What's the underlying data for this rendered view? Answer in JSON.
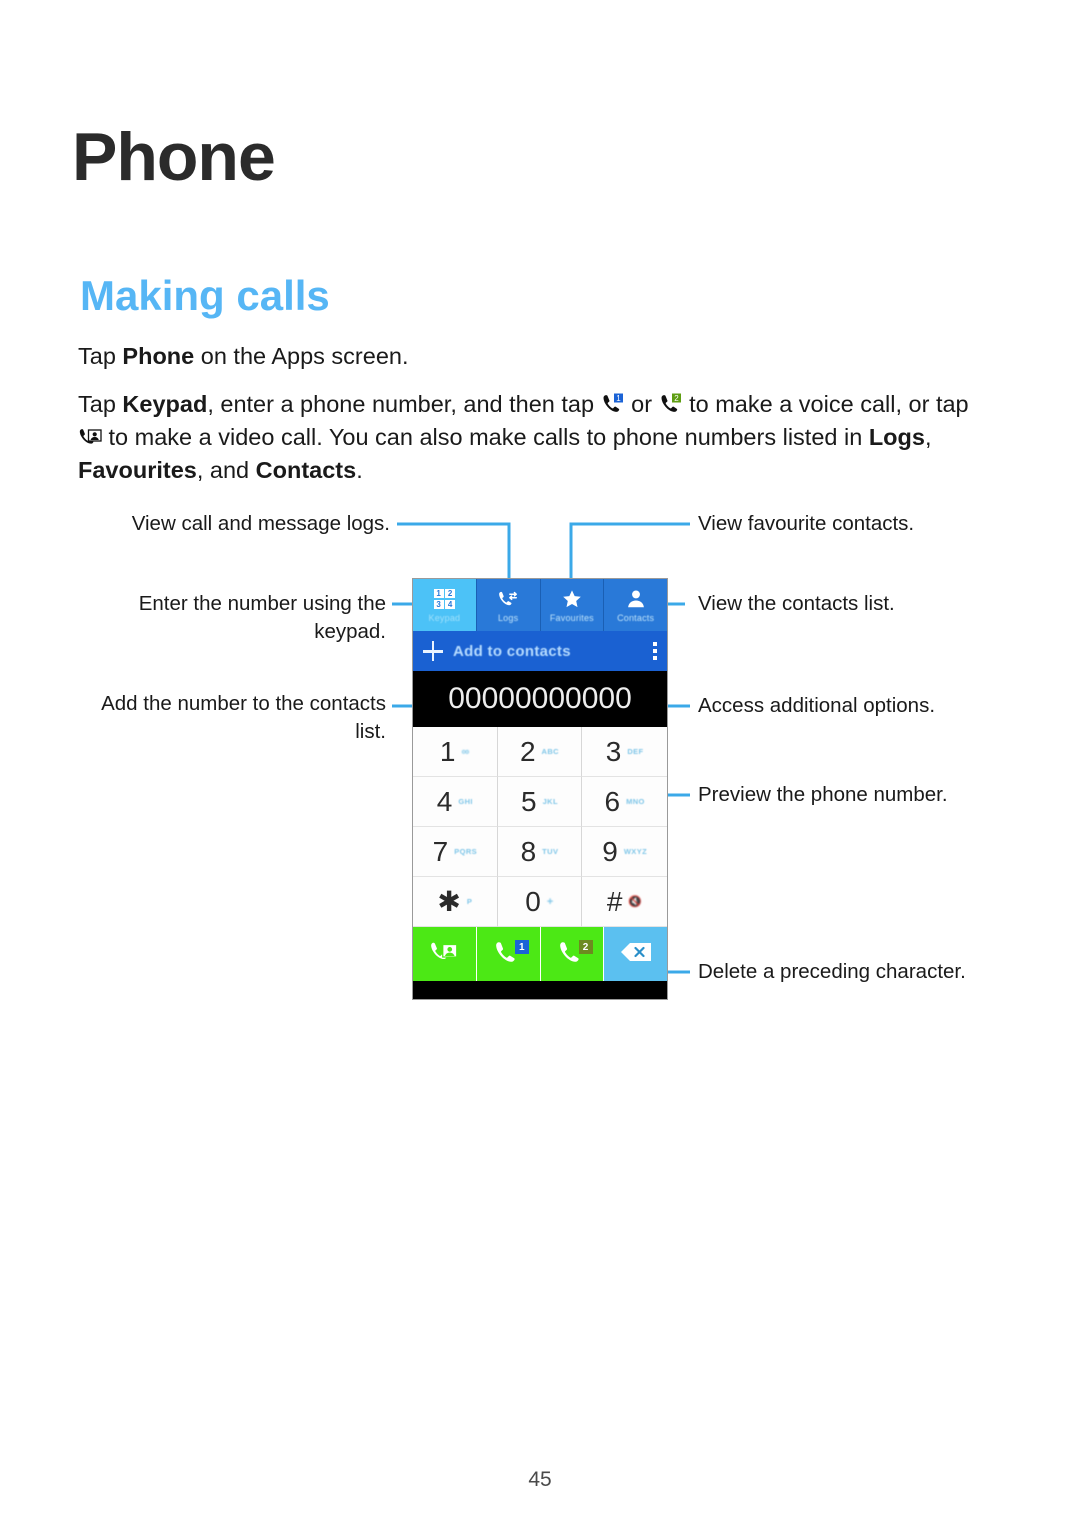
{
  "page": {
    "title": "Phone",
    "section_title": "Making calls",
    "page_number": "45"
  },
  "body": {
    "paragraph1_pre": "Tap ",
    "paragraph1_bold": "Phone",
    "paragraph1_post": " on the Apps screen.",
    "paragraph2_a": "Tap ",
    "paragraph2_b": "Keypad",
    "paragraph2_c": ", enter a phone number, and then tap ",
    "paragraph2_d": " or ",
    "paragraph2_e": " to make a voice call, or tap ",
    "paragraph2_f": " to make a video call. You can also make calls to phone numbers listed in ",
    "paragraph2_g": "Logs",
    "paragraph2_h": ", ",
    "paragraph2_i": "Favourites",
    "paragraph2_j": ", and ",
    "paragraph2_k": "Contacts",
    "paragraph2_l": "."
  },
  "callouts": {
    "view_logs": "View call and message logs.",
    "enter_number": "Enter the number using the\nkeypad.",
    "add_number": "Add the number to the contacts\nlist.",
    "view_favourites": "View favourite contacts.",
    "view_contacts": "View the contacts list.",
    "more_options": "Access additional options.",
    "preview_number": "Preview the phone number.",
    "delete_char": "Delete a preceding character."
  },
  "phone": {
    "tabs": [
      {
        "label": "Keypad",
        "icon": "keypad-grid-icon",
        "selected": true
      },
      {
        "label": "Logs",
        "icon": "call-logs-icon",
        "selected": false
      },
      {
        "label": "Favourites",
        "icon": "star-icon",
        "selected": false
      },
      {
        "label": "Contacts",
        "icon": "person-icon",
        "selected": false
      }
    ],
    "add_to_contacts_label": "Add to contacts",
    "more_options_icon": "more-vertical-icon",
    "number_value": "00000000000",
    "keys": [
      {
        "digit": "1",
        "sub": "∞",
        "sub_kind": "glyph"
      },
      {
        "digit": "2",
        "sub": "ABC",
        "sub_kind": "text"
      },
      {
        "digit": "3",
        "sub": "DEF",
        "sub_kind": "text"
      },
      {
        "digit": "4",
        "sub": "GHI",
        "sub_kind": "text"
      },
      {
        "digit": "5",
        "sub": "JKL",
        "sub_kind": "text"
      },
      {
        "digit": "6",
        "sub": "MNO",
        "sub_kind": "text"
      },
      {
        "digit": "7",
        "sub": "PQRS",
        "sub_kind": "text"
      },
      {
        "digit": "8",
        "sub": "TUV",
        "sub_kind": "text"
      },
      {
        "digit": "9",
        "sub": "WXYZ",
        "sub_kind": "text"
      },
      {
        "digit": "✱",
        "sub": "P",
        "sub_kind": "text"
      },
      {
        "digit": "0",
        "sub": "+",
        "sub_kind": "glyph"
      },
      {
        "digit": "#",
        "sub": "🔇",
        "sub_kind": "glyph"
      }
    ],
    "actions": [
      {
        "name": "video-call",
        "badge": null
      },
      {
        "name": "call-sim-1",
        "badge": "1"
      },
      {
        "name": "call-sim-2",
        "badge": "2"
      },
      {
        "name": "backspace",
        "badge": null
      }
    ]
  },
  "colors": {
    "accent_heading": "#56b6f5",
    "tab_selected": "#4cc2f7",
    "tab_unselected": "#2979d8",
    "add_bar": "#1a61d2",
    "action_green": "#4ce815",
    "action_blue": "#5bc0f0",
    "leader_line": "#3ba9e8"
  }
}
